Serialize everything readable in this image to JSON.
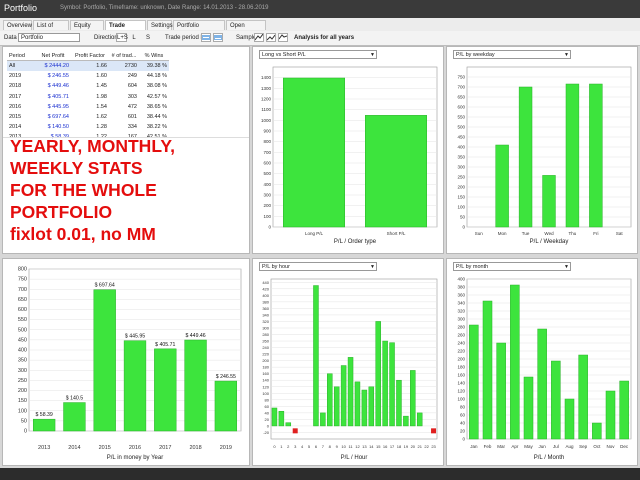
{
  "app": {
    "title": "Portfolio",
    "info": "Symbol: Portfolio, Timeframe: unknown, Date Range: 14.01.2013 - 28.06.2019"
  },
  "tabs": [
    {
      "label": "Overview",
      "active": false
    },
    {
      "label": "List of trades",
      "active": false
    },
    {
      "label": "Equity chart",
      "active": false
    },
    {
      "label": "Trade analysis",
      "active": true
    },
    {
      "label": "Settings",
      "active": false
    },
    {
      "label": "Portfolio correlation",
      "active": false
    },
    {
      "label": "Open balances",
      "active": false
    }
  ],
  "toolbar": {
    "data_label": "Data",
    "data_value": "Portfolio",
    "direction_label": "Direction",
    "direction_options": [
      "L+S",
      "L",
      "S"
    ],
    "trade_period_label": "Trade period by",
    "sample_label": "Sample",
    "analysis_label": "Analysis for all years"
  },
  "stats_table": {
    "headers": [
      "Period",
      "Net Profit",
      "Profit Factor",
      "# of trad...",
      "% Wins"
    ],
    "rows": [
      [
        "All",
        "$ 2444.20",
        "1.66",
        "2730",
        "39.38 %"
      ],
      [
        "2019",
        "$ 246.55",
        "1.60",
        "249",
        "44.18 %"
      ],
      [
        "2018",
        "$ 449.46",
        "1.45",
        "604",
        "38.08 %"
      ],
      [
        "2017",
        "$ 405.71",
        "1.98",
        "303",
        "42.57 %"
      ],
      [
        "2016",
        "$ 445.95",
        "1.54",
        "472",
        "38.65 %"
      ],
      [
        "2015",
        "$ 697.64",
        "1.62",
        "601",
        "38.44 %"
      ],
      [
        "2014",
        "$ 140.50",
        "1.28",
        "334",
        "38.22 %"
      ],
      [
        "2013",
        "$ 58.39",
        "1.22",
        "167",
        "42.51 %"
      ]
    ]
  },
  "overlay_text": [
    "YEARLY, MONTHLY,",
    "WEEKLY STATS",
    "FOR THE WHOLE",
    "PORTFOLIO",
    "fixlot 0.01, no MM"
  ],
  "panels": {
    "order_type": {
      "combo": "Long vs Short P/L"
    },
    "weekday": {
      "combo": "P/L by weekday"
    },
    "hour": {
      "combo": "P/L by hour"
    },
    "month": {
      "combo": "P/L by month"
    }
  },
  "colors": {
    "bar": "#3de43d",
    "bar_edge": "#2bb02b",
    "negative": "#e02020",
    "overlay": "#e40d0d",
    "net_profit": "#1a2fd0"
  },
  "chart_data": [
    {
      "id": "order_type",
      "type": "bar",
      "title": "P/L / Order type",
      "categories": [
        "Long P/L",
        "Short P/L"
      ],
      "values": [
        1397,
        1047
      ],
      "ylim": [
        0,
        1500
      ],
      "yticks": [
        0,
        100,
        200,
        300,
        400,
        500,
        600,
        700,
        800,
        900,
        1000,
        1100,
        1200,
        1300,
        1400
      ],
      "grid": true
    },
    {
      "id": "weekday",
      "type": "bar",
      "title": "P/L / Weekday",
      "categories": [
        "Sun",
        "Mon",
        "Tue",
        "Wed",
        "Thu",
        "Fri",
        "Sat"
      ],
      "values": [
        0,
        410,
        700,
        258,
        715,
        715,
        0
      ],
      "ylim": [
        0,
        800
      ],
      "yticks": [
        0,
        50,
        100,
        150,
        200,
        250,
        300,
        350,
        400,
        450,
        500,
        550,
        600,
        650,
        700,
        750
      ],
      "grid": true
    },
    {
      "id": "year",
      "type": "bar",
      "title": "P/L in money by Year",
      "categories": [
        "2013",
        "2014",
        "2015",
        "2016",
        "2017",
        "2018",
        "2019"
      ],
      "values": [
        58.39,
        140.5,
        697.64,
        445.95,
        405.71,
        449.46,
        246.55
      ],
      "data_labels": [
        "$ 58.39",
        "$ 140.5",
        "$ 697.64",
        "$ 445.95",
        "$ 405.71",
        "$ 449.46",
        "$ 246.55"
      ],
      "ylim": [
        0,
        800
      ],
      "yticks": [
        0,
        50,
        100,
        150,
        200,
        250,
        300,
        350,
        400,
        450,
        500,
        550,
        600,
        650,
        700,
        750,
        800
      ],
      "grid": true
    },
    {
      "id": "hour",
      "type": "bar",
      "title": "P/L / Hour",
      "categories": [
        "0",
        "1",
        "2",
        "3",
        "4",
        "5",
        "6",
        "7",
        "8",
        "9",
        "10",
        "11",
        "12",
        "13",
        "14",
        "15",
        "16",
        "17",
        "18",
        "19",
        "20",
        "21",
        "22",
        "23"
      ],
      "values": [
        55,
        45,
        10,
        -15,
        0,
        0,
        430,
        40,
        160,
        120,
        185,
        210,
        135,
        110,
        120,
        320,
        260,
        255,
        140,
        30,
        170,
        40,
        0,
        -15
      ],
      "ylim": [
        -40,
        450
      ],
      "yticks": [
        -20,
        0,
        20,
        40,
        60,
        80,
        100,
        120,
        140,
        160,
        180,
        200,
        220,
        240,
        260,
        280,
        300,
        320,
        340,
        360,
        380,
        400,
        420,
        440
      ],
      "grid": true
    },
    {
      "id": "month",
      "type": "bar",
      "title": "P/L / Month",
      "categories": [
        "Jan",
        "Feb",
        "Mar",
        "Apr",
        "May",
        "Jun",
        "Jul",
        "Aug",
        "Sep",
        "Oct",
        "Nov",
        "Dec"
      ],
      "values": [
        285,
        345,
        240,
        385,
        155,
        275,
        195,
        100,
        210,
        40,
        120,
        145
      ],
      "ylim": [
        0,
        400
      ],
      "yticks": [
        0,
        20,
        40,
        60,
        80,
        100,
        120,
        140,
        160,
        180,
        200,
        220,
        240,
        260,
        280,
        300,
        320,
        340,
        360,
        380,
        400
      ],
      "grid": true
    }
  ]
}
